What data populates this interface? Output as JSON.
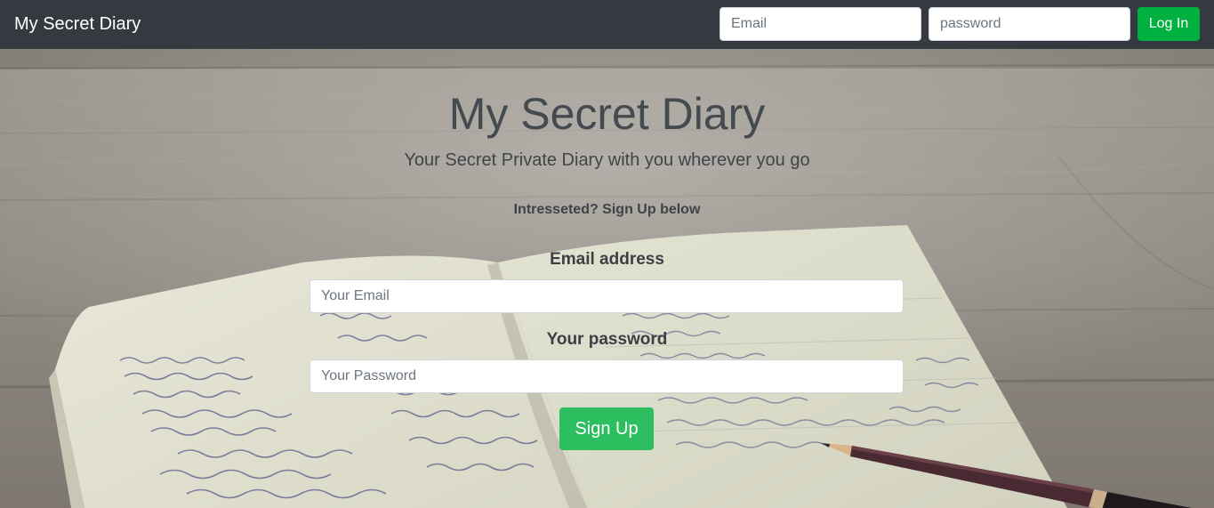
{
  "navbar": {
    "brand": "My Secret Diary",
    "email_placeholder": "Email",
    "password_placeholder": "password",
    "login_label": "Log In"
  },
  "hero": {
    "title": "My Secret Diary",
    "subtitle": "Your Secret Private Diary with you wherever you go",
    "interested": "Intresseted? Sign Up below"
  },
  "signup_form": {
    "email_label": "Email address",
    "email_placeholder": "Your Email",
    "password_label": "Your password",
    "password_placeholder": "Your Password",
    "submit_label": "Sign Up"
  },
  "colors": {
    "navbar": "#343a40",
    "login_button": "#00b140",
    "signup_button": "#2dbe60"
  }
}
